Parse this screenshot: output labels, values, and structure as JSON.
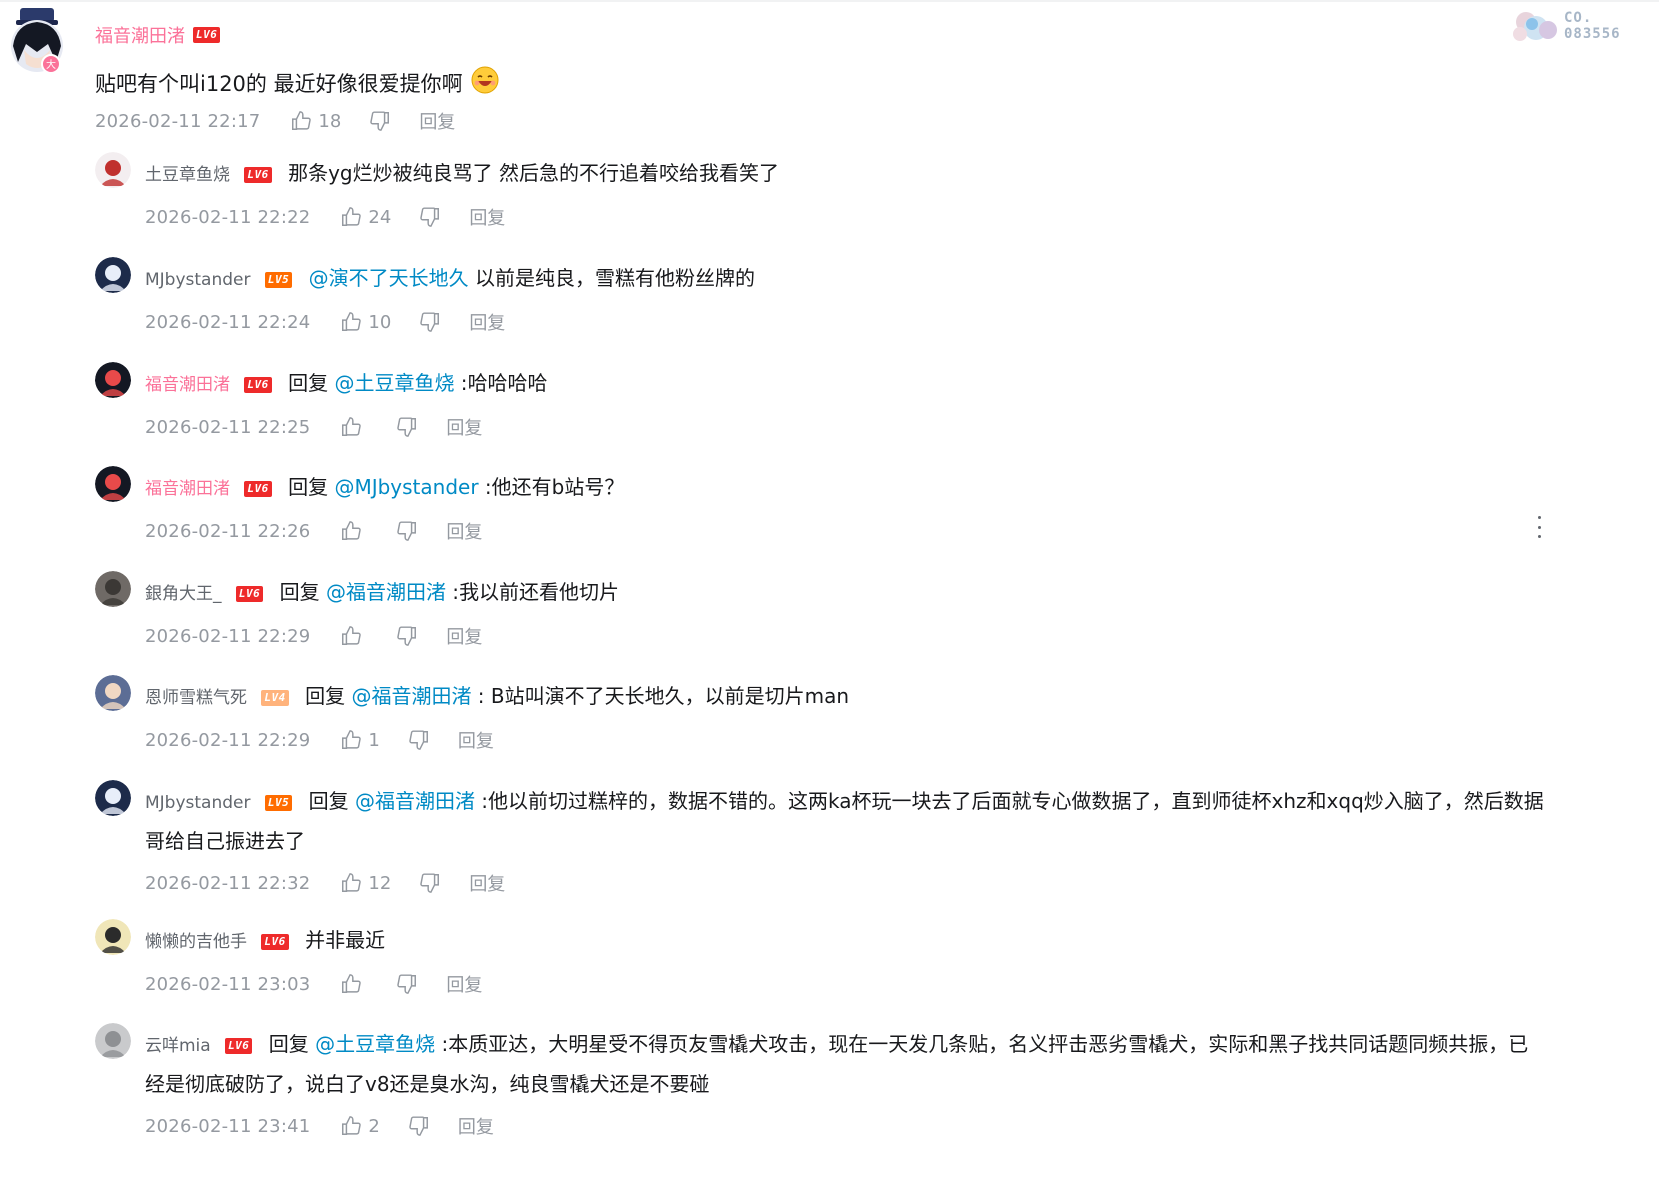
{
  "fan_card": {
    "line1": "CO.",
    "line2": "083556"
  },
  "root_comment": {
    "user": "福音潮田渚",
    "level": "LV6",
    "text": "贴吧有个叫i120的 最近好像很爱提你啊",
    "emoji_icon": "laughing-emoji-icon",
    "time": "2026-02-11 22:17",
    "likes": "18",
    "reply_label": "回复"
  },
  "replies": [
    {
      "user": "土豆章鱼烧",
      "level": "LV6",
      "prefix": "",
      "mention": "",
      "sep": "",
      "text": "那条yg烂炒被纯良骂了 然后急的不行追着咬给我看笑了",
      "time": "2026-02-11 22:22",
      "likes": "24",
      "reply_label": "回复"
    },
    {
      "user": "MJbystander",
      "level": "LV5",
      "prefix": "",
      "mention": "@演不了天长地久",
      "sep": " ",
      "text": "以前是纯良，雪糕有他粉丝牌的",
      "time": "2026-02-11 22:24",
      "likes": "10",
      "reply_label": "回复"
    },
    {
      "user": "福音潮田渚",
      "level": "LV6",
      "prefix": "回复 ",
      "mention": "@土豆章鱼烧",
      "sep": " :",
      "text": "哈哈哈哈",
      "time": "2026-02-11 22:25",
      "likes": "",
      "reply_label": "回复"
    },
    {
      "user": "福音潮田渚",
      "level": "LV6",
      "prefix": "回复 ",
      "mention": "@MJbystander",
      "sep": " :",
      "text": "他还有b站号？",
      "time": "2026-02-11 22:26",
      "likes": "",
      "reply_label": "回复"
    },
    {
      "user": "銀角大王_",
      "level": "LV6",
      "prefix": "回复 ",
      "mention": "@福音潮田渚",
      "sep": " :",
      "text": "我以前还看他切片",
      "time": "2026-02-11 22:29",
      "likes": "",
      "reply_label": "回复"
    },
    {
      "user": "恩师雪糕气死",
      "level": "LV4",
      "prefix": "回复 ",
      "mention": "@福音潮田渚",
      "sep": " : ",
      "text": "B站叫演不了天长地久，以前是切片man",
      "time": "2026-02-11 22:29",
      "likes": "1",
      "reply_label": "回复"
    },
    {
      "user": "MJbystander",
      "level": "LV5",
      "prefix": "回复 ",
      "mention": "@福音潮田渚",
      "sep": " :",
      "text": "他以前切过糕梓的，数据不错的。这两ka杯玩一块去了后面就专心做数据了，直到师徒杯xhz和xqq炒入脑了，然后数据哥给自己振进去了",
      "time": "2026-02-11 22:32",
      "likes": "12",
      "reply_label": "回复"
    },
    {
      "user": "懒懒的吉他手",
      "level": "LV6",
      "prefix": "",
      "mention": "",
      "sep": "",
      "text": "并非最近",
      "time": "2026-02-11 23:03",
      "likes": "",
      "reply_label": "回复"
    },
    {
      "user": "云咩mia",
      "level": "LV6",
      "prefix": "回复 ",
      "mention": "@土豆章鱼烧",
      "sep": " :",
      "text": "本质亚达，大明星受不得页友雪橇犬攻击，现在一天发几条贴，名义抨击恶劣雪橇犬，实际和黑子找共同话题同频共振，已经是彻底破防了，说白了v8还是臭水沟，纯良雪橇犬还是不要碰",
      "time": "2026-02-11 23:41",
      "likes": "2",
      "reply_label": "回复"
    }
  ],
  "colors": {
    "vip_name": "#fb7299",
    "mention": "#008ac5",
    "meta": "#9499a0",
    "level6": "#ee2a2a",
    "level5": "#ff6c00",
    "level4": "#ffb37c"
  }
}
